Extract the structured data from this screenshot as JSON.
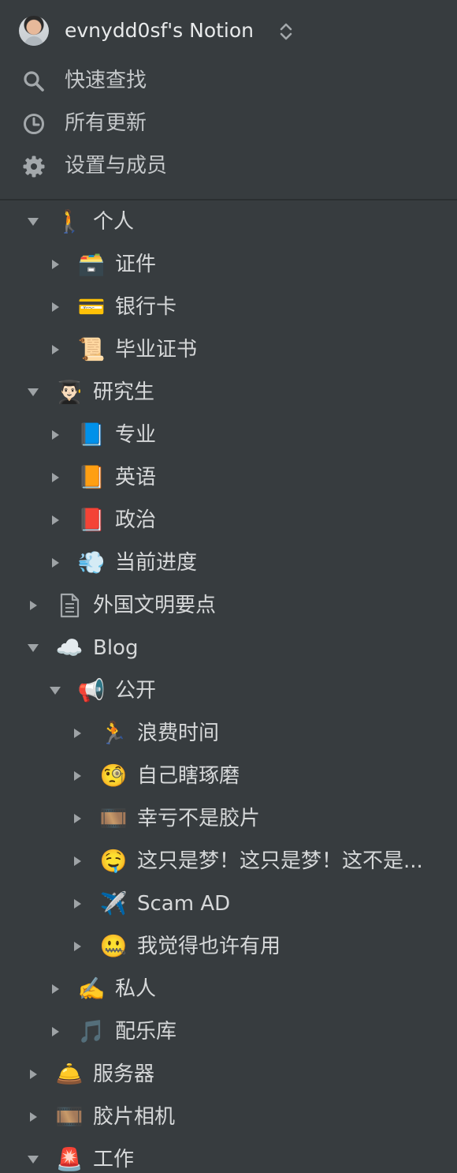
{
  "workspace": {
    "name": "evnydd0sf's Notion"
  },
  "quick_actions": [
    {
      "label": "快速查找",
      "icon": "search-icon"
    },
    {
      "label": "所有更新",
      "icon": "clock-icon"
    },
    {
      "label": "设置与成员",
      "icon": "gear-icon"
    }
  ],
  "tree": [
    {
      "label": "个人",
      "icon": "🚶",
      "expanded": true
    },
    {
      "label": "证件",
      "icon": "🗃️",
      "expanded": false
    },
    {
      "label": "银行卡",
      "icon": "💳",
      "expanded": false
    },
    {
      "label": "毕业证书",
      "icon": "📜",
      "expanded": false
    },
    {
      "label": "研究生",
      "icon": "👨🏻‍🎓",
      "expanded": true
    },
    {
      "label": "专业",
      "icon": "📘",
      "expanded": false
    },
    {
      "label": "英语",
      "icon": "📙",
      "expanded": false
    },
    {
      "label": "政治",
      "icon": "📕",
      "expanded": false
    },
    {
      "label": "当前进度",
      "icon": "💨",
      "expanded": false
    },
    {
      "label": "外国文明要点",
      "icon": "page-icon",
      "expanded": false
    },
    {
      "label": "Blog",
      "icon": "☁️",
      "expanded": true
    },
    {
      "label": "公开",
      "icon": "📢",
      "expanded": true
    },
    {
      "label": "浪费时间",
      "icon": "🏃",
      "expanded": false
    },
    {
      "label": "自己瞎琢磨",
      "icon": "🧐",
      "expanded": false
    },
    {
      "label": "幸亏不是胶片",
      "icon": "🎞️",
      "expanded": false
    },
    {
      "label": "这只是梦！这只是梦！这不是...",
      "icon": "🤤",
      "expanded": false
    },
    {
      "label": "Scam AD",
      "icon": "✈️",
      "expanded": false
    },
    {
      "label": "我觉得也许有用",
      "icon": "🤐",
      "expanded": false
    },
    {
      "label": "私人",
      "icon": "✍️",
      "expanded": false
    },
    {
      "label": "配乐库",
      "icon": "🎵",
      "expanded": false
    },
    {
      "label": "服务器",
      "icon": "🛎️",
      "expanded": false
    },
    {
      "label": "胶片相机",
      "icon": "🎞️",
      "expanded": false
    },
    {
      "label": "工作",
      "icon": "🚨",
      "expanded": true
    }
  ],
  "colors": {
    "background": "#373c3f",
    "text": "#d6d8d9",
    "muted": "#9ea3a6"
  }
}
